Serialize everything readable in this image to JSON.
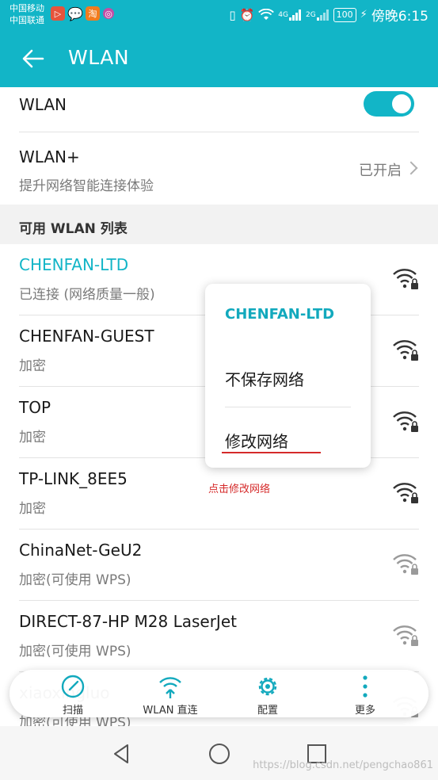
{
  "status_bar": {
    "carrier_1": "中国移动",
    "carrier_2": "中国联通",
    "notification_icons": [
      "video-app-icon",
      "chat-bubble-icon",
      "taobao-icon",
      "app-circle-icon"
    ],
    "network_1": "4G",
    "network_2": "2G",
    "battery": "100",
    "time": "傍晚6:15"
  },
  "app_bar": {
    "title": "WLAN"
  },
  "wlan_row": {
    "label": "WLAN",
    "enabled": true
  },
  "wlan_plus_row": {
    "label": "WLAN+",
    "subtitle": "提升网络智能连接体验",
    "status": "已开启"
  },
  "section": {
    "title": "可用 WLAN 列表"
  },
  "networks": [
    {
      "ssid": "CHENFAN-LTD",
      "status": "已连接 (网络质量一般)",
      "connected": true
    },
    {
      "ssid": "CHENFAN-GUEST",
      "status": "加密",
      "connected": false
    },
    {
      "ssid": "TOP",
      "status": "加密",
      "connected": false
    },
    {
      "ssid": "TP-LINK_8EE5",
      "status": "加密",
      "connected": false
    },
    {
      "ssid": "ChinaNet-GeU2",
      "status": "加密(可使用 WPS)",
      "connected": false
    },
    {
      "ssid": "DIRECT-87-HP M28 LaserJet",
      "status": "加密(可使用 WPS)",
      "connected": false
    },
    {
      "ssid": "xiaoxingluo",
      "status": "加密(可使用 WPS)",
      "connected": false
    }
  ],
  "popup": {
    "title": "CHENFAN-LTD",
    "item_forget": "不保存网络",
    "item_modify": "修改网络"
  },
  "annotation": "点击修改网络",
  "toolbar": {
    "scan": "扫描",
    "wlan_direct": "WLAN 直连",
    "config": "配置",
    "more": "更多"
  },
  "watermark": "https://blog.csdn.net/pengchao861",
  "colors": {
    "accent": "#12b5c7",
    "annotation": "#d52a2a"
  }
}
